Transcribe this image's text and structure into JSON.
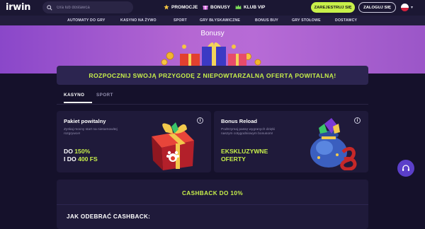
{
  "header": {
    "logo": "irwin",
    "search_placeholder": "Gra lub dostawca",
    "promo_links": [
      {
        "label": "PROMOCJE",
        "icon": "star-icon",
        "color": "#f5c542"
      },
      {
        "label": "BONUSY",
        "icon": "gift-icon",
        "color": "#d46be0"
      },
      {
        "label": "KLUB VIP",
        "icon": "crown-icon",
        "color": "#7ee05a"
      }
    ],
    "register_label": "ZAREJESTRUJ SIĘ",
    "login_label": "ZALOGUJ SIĘ",
    "language_flag": "flag-pl-icon"
  },
  "categories": [
    "AUTOMATY DO GRY",
    "KASYNO NA ŻYWO",
    "SPORT",
    "GRY BŁYSKAWICZNE",
    "BONUS BUY",
    "GRY STOŁOWE",
    "DOSTAWCY"
  ],
  "hero": {
    "title": "Bonusy"
  },
  "promo_banner": "ROZPOCZNIJ SWOJĄ PRZYGODĘ Z NIEPOWTARZALNĄ OFERTĄ POWITALNĄ!",
  "tabs": [
    {
      "label": "KASYNO",
      "active": true
    },
    {
      "label": "SPORT",
      "active": false
    }
  ],
  "cards": [
    {
      "title": "Pakiet powitalny",
      "description": "Zyskaj mocny start na niesamowitej rozgrywce!",
      "line1_prefix": "DO ",
      "line1_value": "150%",
      "line2_prefix": "I DO ",
      "line2_value": "400 FS"
    },
    {
      "title": "Bonus Reload",
      "description": "Podtrzymaj passę wygranych dzięki naszym cotygodniowym bonusom!",
      "line1": "EKSKLUZYWNE",
      "line2": "OFERTY"
    }
  ],
  "cashback": {
    "title": "CASHBACK DO 10%",
    "subtitle": "JAK ODEBRAĆ CASHBACK:"
  },
  "colors": {
    "accent": "#c8f04a",
    "background": "#15112b",
    "card": "#1f1a3a"
  }
}
